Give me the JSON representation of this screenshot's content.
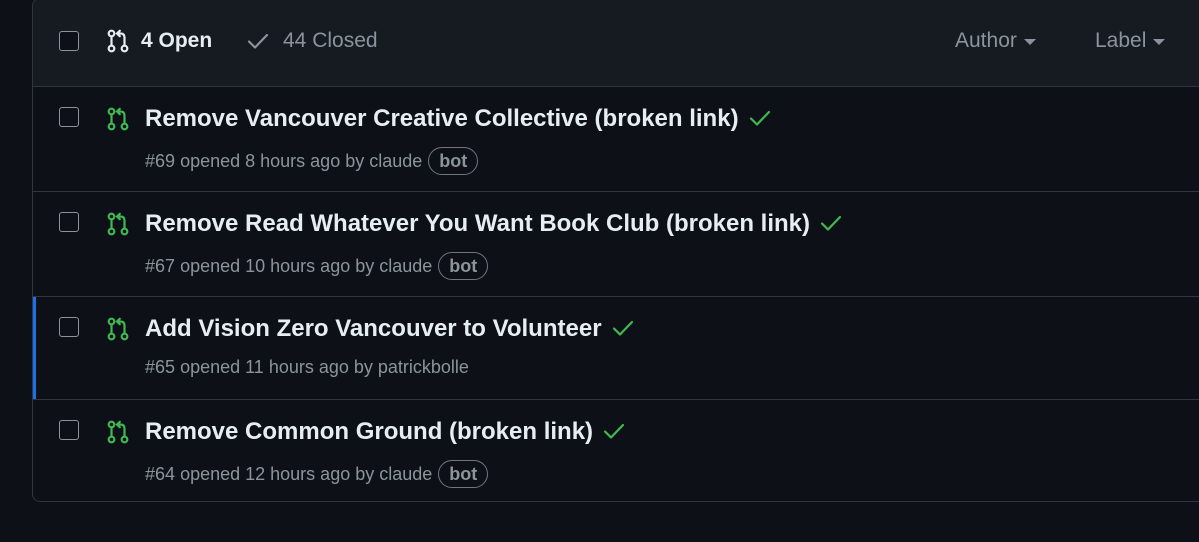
{
  "header": {
    "open_label": "4 Open",
    "closed_label": "44 Closed",
    "filters": [
      {
        "label": "Author"
      },
      {
        "label": "Label"
      }
    ]
  },
  "pull_requests": [
    {
      "title": "Remove Vancouver Creative Collective (broken link)",
      "number": "#69",
      "opened": "opened 8 hours ago by",
      "author": "claude",
      "badge": "bot",
      "status": "success"
    },
    {
      "title": "Remove Read Whatever You Want Book Club (broken link)",
      "number": "#67",
      "opened": "opened 10 hours ago by",
      "author": "claude",
      "badge": "bot",
      "status": "success"
    },
    {
      "title": "Add Vision Zero Vancouver to Volunteer",
      "number": "#65",
      "opened": "opened 11 hours ago by",
      "author": "patrickbolle",
      "badge": "",
      "status": "success"
    },
    {
      "title": "Remove Common Ground (broken link)",
      "number": "#64",
      "opened": "opened 12 hours ago by",
      "author": "claude",
      "badge": "bot",
      "status": "success"
    }
  ],
  "colors": {
    "background": "#0d1117",
    "header_bg": "#161b22",
    "open_icon": "#3fb950",
    "success_check": "#3fb950",
    "selected_accent": "#1f6feb",
    "muted_text": "#8b949e"
  },
  "icons": {
    "open": "git-pull-request-icon",
    "closed": "check-icon",
    "status": "check-icon",
    "dropdown": "caret-down-icon"
  }
}
